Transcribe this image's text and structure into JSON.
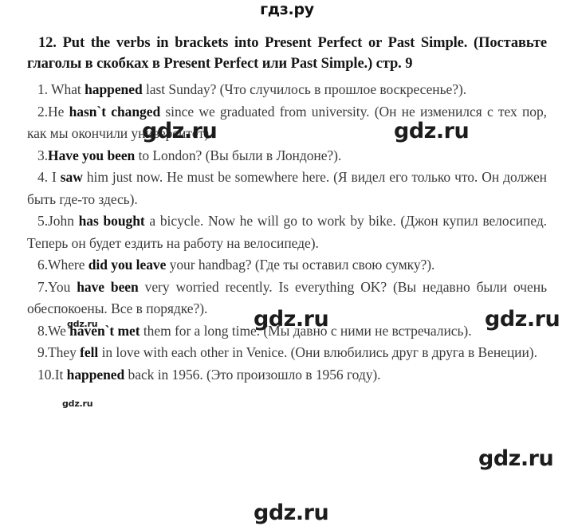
{
  "site": {
    "logo": "гдз.ру",
    "watermark_large": "gdz.ru",
    "watermark_small": "gdz.ru"
  },
  "task": {
    "number": "12.",
    "title_en": "12. Put the verbs in brackets into Present Perfect or Past Simple.",
    "title_ru": "(Поставьте глаголы в скобках в Present Perfect или Past Simple.)",
    "page_ref": "стр. 9",
    "title_full": "12. Put the verbs in brackets into Present Perfect or Past Simple. (Поставьте глаголы в скобках в Present Perfect или Past Simple.) стр. 9"
  },
  "items": [
    {
      "num": "1. ",
      "before": "What ",
      "verb": "happened",
      "after": " last Sunday? (Что случилось в прошлое воскресенье?)."
    },
    {
      "num": "2.",
      "before": "He ",
      "verb": "hasn`t changed",
      "after": " since we graduated from university. (Он не изменился с тех пор, как мы окончили университет)."
    },
    {
      "num": "3.",
      "before": "",
      "verb": "Have you been",
      "after": " to London? (Вы были в Лондоне?)."
    },
    {
      "num": "4. ",
      "before": "I ",
      "verb": "saw",
      "after": " him just now. He must be somewhere here. (Я видел его только что. Он должен быть где-то здесь)."
    },
    {
      "num": "5.",
      "before": "John ",
      "verb": "has bought",
      "after": " a bicycle. Now he will go to work by bike. (Джон купил велосипед. Теперь он будет ездить на работу на велосипеде)."
    },
    {
      "num": "6.",
      "before": "Where ",
      "verb": "did you leave",
      "after": " your handbag? (Где ты оставил свою сумку?)."
    },
    {
      "num": "7.",
      "before": "You ",
      "verb": "have been",
      "after": " very worried recently. Is everything OK? (Вы недавно были очень обеспокоены. Все в порядке?)."
    },
    {
      "num": "8.",
      "before": "We ",
      "verb": "haven`t met",
      "after": " them for a long time. (Мы давно с ними не встречались)."
    },
    {
      "num": "9.",
      "before": "They ",
      "verb": "fell",
      "after": " in love with each other in Venice. (Они влюбились друг в друга в Венеции)."
    },
    {
      "num": "10.",
      "before": "It ",
      "verb": "happened",
      "after": " back in 1956. (Это произошло в 1956 году)."
    }
  ]
}
